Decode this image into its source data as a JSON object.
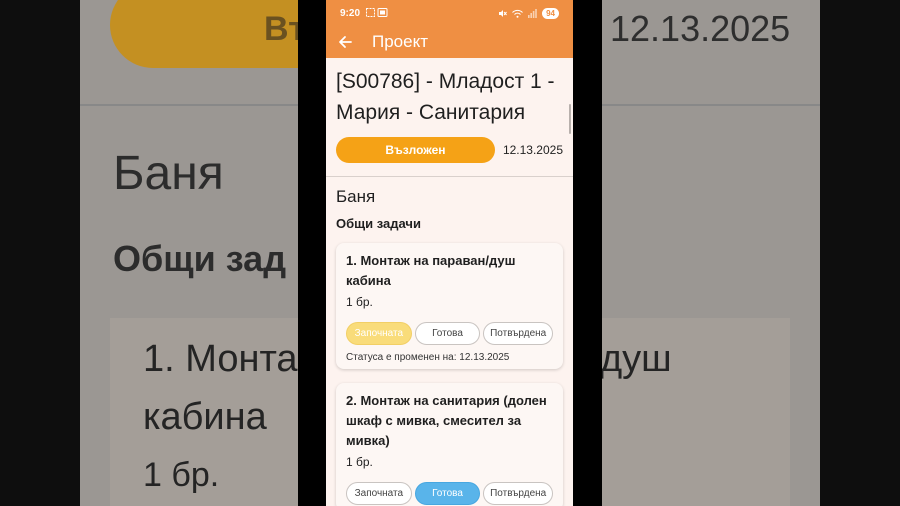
{
  "status_bar": {
    "time": "9:20",
    "battery": "94"
  },
  "appbar": {
    "title": "Проект"
  },
  "project": {
    "title": "[S00786] - Младост 1 - Мария - Санитария",
    "status_label": "Възложен",
    "date": "12.13.2025"
  },
  "section": {
    "title": "Баня",
    "subsection": "Общи задачи"
  },
  "tasks": [
    {
      "title": "1. Монтаж на параван/душ кабина",
      "qty": "1 бр.",
      "chips": [
        "Започната",
        "Готова",
        "Потвърдена"
      ],
      "active_chip": "Започната",
      "status_changed": "Статуса е променен на: 12.13.2025"
    },
    {
      "title": "2. Монтаж на санитария (долен шкаф с мивка, смесител за мивка)",
      "qty": "1 бр.",
      "chips": [
        "Започната",
        "Готова",
        "Потвърдена"
      ],
      "active_chip": "Готова"
    }
  ],
  "background": {
    "pill_text": "Въ",
    "date": "12.13.2025",
    "heading": "Баня",
    "subheading": "Общи зад",
    "task_line1": "1. Монта",
    "task_line2": "кабина",
    "task_line3": "1 бр.",
    "task_right": "душ"
  },
  "colors": {
    "accent": "#ef8f43",
    "status_pill": "#f5a216",
    "chip_started": "#f9dc7a",
    "chip_done": "#59b4ea",
    "screen_bg": "#fdf3ef"
  }
}
